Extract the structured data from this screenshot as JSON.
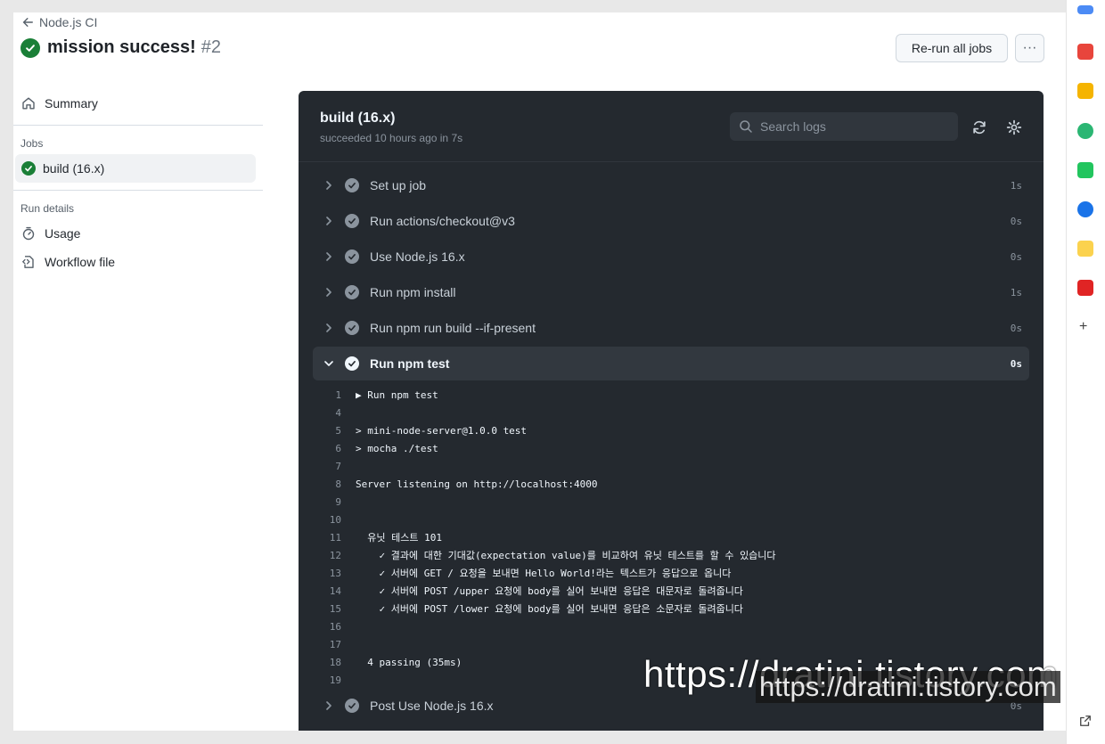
{
  "header": {
    "back_label": "Node.js CI",
    "title": "mission success!",
    "run_number": "#2",
    "rerun_label": "Re-run all jobs",
    "more_label": "···"
  },
  "sidebar": {
    "summary_label": "Summary",
    "jobs_heading": "Jobs",
    "job_label": "build (16.x)",
    "run_details_heading": "Run details",
    "usage_label": "Usage",
    "workflow_label": "Workflow file"
  },
  "job": {
    "title": "build (16.x)",
    "subtitle": "succeeded 10 hours ago in 7s",
    "search_placeholder": "Search logs"
  },
  "steps_before": [
    {
      "name": "Set up job",
      "duration": "1s"
    },
    {
      "name": "Run actions/checkout@v3",
      "duration": "0s"
    },
    {
      "name": "Use Node.js 16.x",
      "duration": "0s"
    },
    {
      "name": "Run npm install",
      "duration": "1s"
    },
    {
      "name": "Run npm run build --if-present",
      "duration": "0s"
    }
  ],
  "open_step": {
    "name": "Run npm test",
    "duration": "0s"
  },
  "log_lines": [
    {
      "n": "1",
      "text": "▶ Run npm test"
    },
    {
      "n": "4",
      "text": ""
    },
    {
      "n": "5",
      "text": "> mini-node-server@1.0.0 test"
    },
    {
      "n": "6",
      "text": "> mocha ./test"
    },
    {
      "n": "7",
      "text": ""
    },
    {
      "n": "8",
      "text": "Server listening on http://localhost:4000"
    },
    {
      "n": "9",
      "text": ""
    },
    {
      "n": "10",
      "text": ""
    },
    {
      "n": "11",
      "text": "  유닛 테스트 101"
    },
    {
      "n": "12",
      "text": "    ✓ 결과에 대한 기대값(expectation value)를 비교하여 유닛 테스트를 할 수 있습니다"
    },
    {
      "n": "13",
      "text": "    ✓ 서버에 GET / 요청을 보내면 Hello World!라는 텍스트가 응답으로 옵니다"
    },
    {
      "n": "14",
      "text": "    ✓ 서버에 POST /upper 요청에 body를 실어 보내면 응답은 대문자로 돌려줍니다"
    },
    {
      "n": "15",
      "text": "    ✓ 서버에 POST /lower 요청에 body를 실어 보내면 응답은 소문자로 돌려줍니다"
    },
    {
      "n": "16",
      "text": ""
    },
    {
      "n": "17",
      "text": ""
    },
    {
      "n": "18",
      "text": "  4 passing (35ms)"
    },
    {
      "n": "19",
      "text": ""
    }
  ],
  "step_after": {
    "name": "Post Use Node.js 16.x",
    "duration": "0s"
  },
  "watermark": {
    "text_large": "https://dratini.tistory.com",
    "text_small": "https://dratini.tistory.com"
  },
  "colors": {
    "success": "#1a7f37",
    "panel_bg": "#24292f",
    "panel_text": "#f0f6fc"
  }
}
